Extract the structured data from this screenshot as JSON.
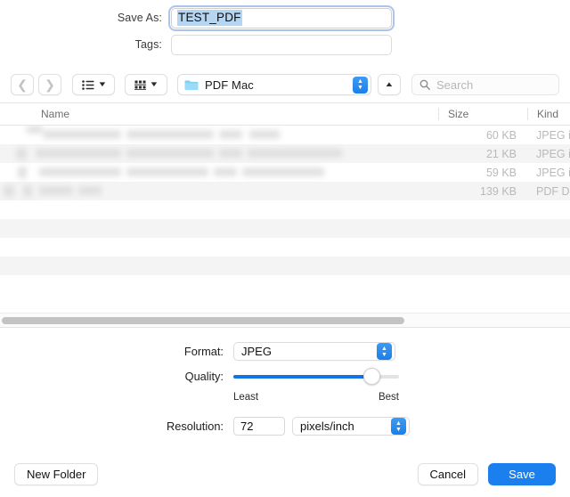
{
  "save_as": {
    "label": "Save As:",
    "value": "TEST_PDF",
    "selected": true
  },
  "tags": {
    "label": "Tags:",
    "value": "",
    "placeholder": ""
  },
  "toolbar": {
    "back_icon": "chevron-left-icon",
    "forward_icon": "chevron-right-icon",
    "view_list_icon": "list-view-icon",
    "view_dropdown_icon": "chevron-down-icon",
    "group_icon": "group-view-icon",
    "group_dropdown_icon": "chevron-down-icon",
    "path": {
      "folder_icon": "folder-icon",
      "name": "PDF Mac",
      "stepper_up": "▲",
      "stepper_down": "▼"
    },
    "up_button_icon": "chevron-up-icon",
    "search": {
      "icon": "search-icon",
      "placeholder": "Search",
      "value": ""
    }
  },
  "file_browser": {
    "columns": [
      {
        "key": "name",
        "label": "Name"
      },
      {
        "key": "size",
        "label": "Size"
      },
      {
        "key": "kind",
        "label": "Kind"
      }
    ],
    "rows": [
      {
        "name": "",
        "size": "60 KB",
        "kind": "JPEG in"
      },
      {
        "name": "",
        "size": "21 KB",
        "kind": "JPEG in"
      },
      {
        "name": "",
        "size": "59 KB",
        "kind": "JPEG in"
      },
      {
        "name": "",
        "size": "139 KB",
        "kind": "PDF Do"
      }
    ],
    "scrollbar": {
      "orientation": "horizontal",
      "thumb_percent": 71
    }
  },
  "options": {
    "format": {
      "label": "Format:",
      "value": "JPEG"
    },
    "quality": {
      "label": "Quality:",
      "value": 83,
      "min_label": "Least",
      "max_label": "Best"
    },
    "resolution": {
      "label": "Resolution:",
      "value": "72",
      "unit": "pixels/inch"
    }
  },
  "footer": {
    "new_folder_label": "New Folder",
    "cancel_label": "Cancel",
    "save_label": "Save"
  },
  "colors": {
    "accent": "#1c7fee",
    "slider_fill": "#1273e6",
    "selection": "#b6d5f0",
    "folder": "#7fd0f5"
  }
}
